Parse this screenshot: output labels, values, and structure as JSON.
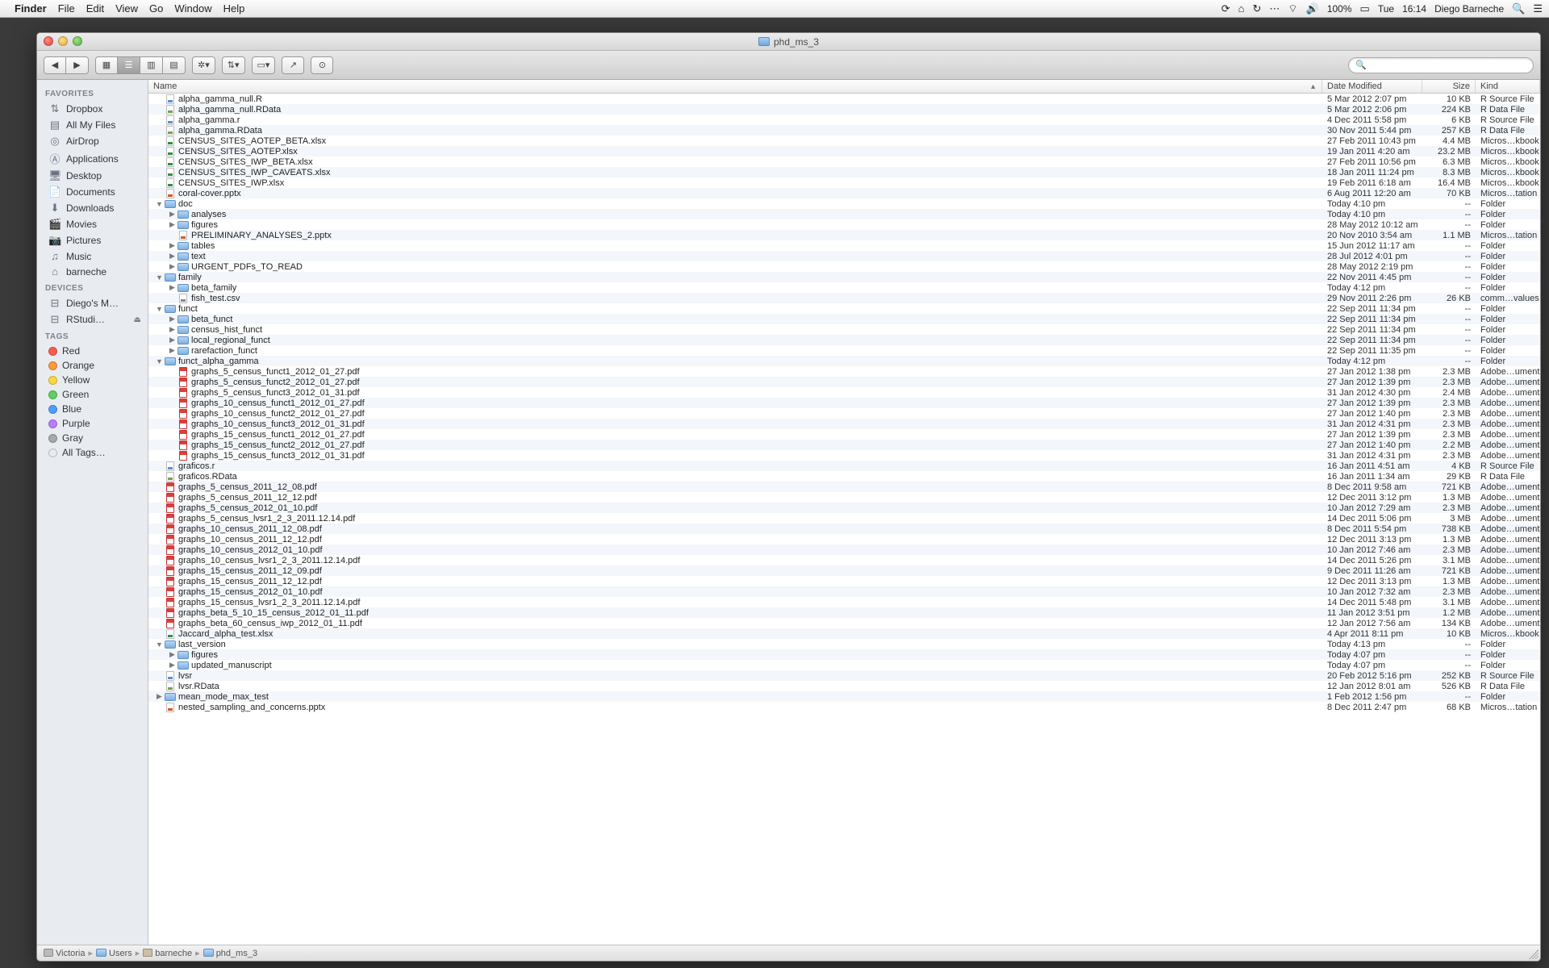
{
  "menubar": {
    "app": "Finder",
    "items": [
      "File",
      "Edit",
      "View",
      "Go",
      "Window",
      "Help"
    ],
    "battery": "100%",
    "day": "Tue",
    "time": "16:14",
    "user": "Diego Barneche"
  },
  "window": {
    "title": "phd_ms_3",
    "search_placeholder": ""
  },
  "sidebar": {
    "sections": [
      {
        "title": "FAVORITES",
        "items": [
          {
            "icon": "dropbox",
            "label": "Dropbox"
          },
          {
            "icon": "allfiles",
            "label": "All My Files"
          },
          {
            "icon": "airdrop",
            "label": "AirDrop"
          },
          {
            "icon": "apps",
            "label": "Applications"
          },
          {
            "icon": "desktop",
            "label": "Desktop"
          },
          {
            "icon": "docs",
            "label": "Documents"
          },
          {
            "icon": "downloads",
            "label": "Downloads"
          },
          {
            "icon": "movies",
            "label": "Movies"
          },
          {
            "icon": "pictures",
            "label": "Pictures"
          },
          {
            "icon": "music",
            "label": "Music"
          },
          {
            "icon": "home",
            "label": "barneche"
          }
        ]
      },
      {
        "title": "DEVICES",
        "items": [
          {
            "icon": "disk",
            "label": "Diego's M…"
          },
          {
            "icon": "disk",
            "label": "RStudi…",
            "eject": true
          }
        ]
      },
      {
        "title": "TAGS",
        "items": [
          {
            "tag": "#ff5b4f",
            "label": "Red"
          },
          {
            "tag": "#ff9a3c",
            "label": "Orange"
          },
          {
            "tag": "#ffd93c",
            "label": "Yellow"
          },
          {
            "tag": "#5fcf5f",
            "label": "Green"
          },
          {
            "tag": "#4f9eff",
            "label": "Blue"
          },
          {
            "tag": "#b97dff",
            "label": "Purple"
          },
          {
            "tag": "#a8a8a8",
            "label": "Gray"
          },
          {
            "tag": "transparent",
            "label": "All Tags…",
            "border": "#bbb"
          }
        ]
      }
    ]
  },
  "columns": {
    "name": "Name",
    "date": "Date Modified",
    "size": "Size",
    "kind": "Kind"
  },
  "pathbar": [
    "Victoria",
    "Users",
    "barneche",
    "phd_ms_3"
  ],
  "files": [
    {
      "d": 0,
      "t": null,
      "k": "r",
      "n": "alpha_gamma_null.R",
      "dm": "5 Mar 2012 2:07 pm",
      "sz": "10 KB",
      "kd": "R Source File"
    },
    {
      "d": 0,
      "t": null,
      "k": "rd",
      "n": "alpha_gamma_null.RData",
      "dm": "5 Mar 2012 2:06 pm",
      "sz": "224 KB",
      "kd": "R Data File"
    },
    {
      "d": 0,
      "t": null,
      "k": "r",
      "n": "alpha_gamma.r",
      "dm": "4 Dec 2011 5:58 pm",
      "sz": "6 KB",
      "kd": "R Source File"
    },
    {
      "d": 0,
      "t": null,
      "k": "rd",
      "n": "alpha_gamma.RData",
      "dm": "30 Nov 2011 5:44 pm",
      "sz": "257 KB",
      "kd": "R Data File"
    },
    {
      "d": 0,
      "t": null,
      "k": "xl",
      "n": "CENSUS_SITES_AOTEP_BETA.xlsx",
      "dm": "27 Feb 2011 10:43 pm",
      "sz": "4.4 MB",
      "kd": "Micros…kbook"
    },
    {
      "d": 0,
      "t": null,
      "k": "xl",
      "n": "CENSUS_SITES_AOTEP.xlsx",
      "dm": "19 Jan 2011 4:20 am",
      "sz": "23.2 MB",
      "kd": "Micros…kbook"
    },
    {
      "d": 0,
      "t": null,
      "k": "xl",
      "n": "CENSUS_SITES_IWP_BETA.xlsx",
      "dm": "27 Feb 2011 10:56 pm",
      "sz": "6.3 MB",
      "kd": "Micros…kbook"
    },
    {
      "d": 0,
      "t": null,
      "k": "xl",
      "n": "CENSUS_SITES_IWP_CAVEATS.xlsx",
      "dm": "18 Jan 2011 11:24 pm",
      "sz": "8.3 MB",
      "kd": "Micros…kbook"
    },
    {
      "d": 0,
      "t": null,
      "k": "xl",
      "n": "CENSUS_SITES_IWP.xlsx",
      "dm": "19 Feb 2011 6:18 am",
      "sz": "16.4 MB",
      "kd": "Micros…kbook"
    },
    {
      "d": 0,
      "t": null,
      "k": "pp",
      "n": "coral-cover.pptx",
      "dm": "6 Aug 2011 12:20 am",
      "sz": "70 KB",
      "kd": "Micros…tation"
    },
    {
      "d": 0,
      "t": "open",
      "k": "folder",
      "n": "doc",
      "dm": "Today 4:10 pm",
      "sz": "--",
      "kd": "Folder"
    },
    {
      "d": 1,
      "t": "closed",
      "k": "folder",
      "n": "analyses",
      "dm": "Today 4:10 pm",
      "sz": "--",
      "kd": "Folder"
    },
    {
      "d": 1,
      "t": "closed",
      "k": "folder",
      "n": "figures",
      "dm": "28 May 2012 10:12 am",
      "sz": "--",
      "kd": "Folder"
    },
    {
      "d": 1,
      "t": null,
      "k": "pp",
      "n": "PRELIMINARY_ANALYSES_2.pptx",
      "dm": "20 Nov 2010 3:54 am",
      "sz": "1.1 MB",
      "kd": "Micros…tation"
    },
    {
      "d": 1,
      "t": "closed",
      "k": "folder",
      "n": "tables",
      "dm": "15 Jun 2012 11:17 am",
      "sz": "--",
      "kd": "Folder"
    },
    {
      "d": 1,
      "t": "closed",
      "k": "folder",
      "n": "text",
      "dm": "28 Jul 2012 4:01 pm",
      "sz": "--",
      "kd": "Folder"
    },
    {
      "d": 1,
      "t": "closed",
      "k": "folder",
      "n": "URGENT_PDFs_TO_READ",
      "dm": "28 May 2012 2:19 pm",
      "sz": "--",
      "kd": "Folder"
    },
    {
      "d": 0,
      "t": "open",
      "k": "folder",
      "n": "family",
      "dm": "22 Nov 2011 4:45 pm",
      "sz": "--",
      "kd": "Folder"
    },
    {
      "d": 1,
      "t": "closed",
      "k": "folder",
      "n": "beta_family",
      "dm": "Today 4:12 pm",
      "sz": "--",
      "kd": "Folder"
    },
    {
      "d": 1,
      "t": null,
      "k": "csv",
      "n": "fish_test.csv",
      "dm": "29 Nov 2011 2:26 pm",
      "sz": "26 KB",
      "kd": "comm…values"
    },
    {
      "d": 0,
      "t": "open",
      "k": "folder",
      "n": "funct",
      "dm": "22 Sep 2011 11:34 pm",
      "sz": "--",
      "kd": "Folder"
    },
    {
      "d": 1,
      "t": "closed",
      "k": "folder",
      "n": "beta_funct",
      "dm": "22 Sep 2011 11:34 pm",
      "sz": "--",
      "kd": "Folder"
    },
    {
      "d": 1,
      "t": "closed",
      "k": "folder",
      "n": "census_hist_funct",
      "dm": "22 Sep 2011 11:34 pm",
      "sz": "--",
      "kd": "Folder"
    },
    {
      "d": 1,
      "t": "closed",
      "k": "folder",
      "n": "local_regional_funct",
      "dm": "22 Sep 2011 11:34 pm",
      "sz": "--",
      "kd": "Folder"
    },
    {
      "d": 1,
      "t": "closed",
      "k": "folder",
      "n": "rarefaction_funct",
      "dm": "22 Sep 2011 11:35 pm",
      "sz": "--",
      "kd": "Folder"
    },
    {
      "d": 0,
      "t": "open",
      "k": "folder",
      "n": "funct_alpha_gamma",
      "dm": "Today 4:12 pm",
      "sz": "--",
      "kd": "Folder"
    },
    {
      "d": 1,
      "t": null,
      "k": "pdf",
      "n": "graphs_5_census_funct1_2012_01_27.pdf",
      "dm": "27 Jan 2012 1:38 pm",
      "sz": "2.3 MB",
      "kd": "Adobe…ument"
    },
    {
      "d": 1,
      "t": null,
      "k": "pdf",
      "n": "graphs_5_census_funct2_2012_01_27.pdf",
      "dm": "27 Jan 2012 1:39 pm",
      "sz": "2.3 MB",
      "kd": "Adobe…ument"
    },
    {
      "d": 1,
      "t": null,
      "k": "pdf",
      "n": "graphs_5_census_funct3_2012_01_31.pdf",
      "dm": "31 Jan 2012 4:30 pm",
      "sz": "2.4 MB",
      "kd": "Adobe…ument"
    },
    {
      "d": 1,
      "t": null,
      "k": "pdf",
      "n": "graphs_10_census_funct1_2012_01_27.pdf",
      "dm": "27 Jan 2012 1:39 pm",
      "sz": "2.3 MB",
      "kd": "Adobe…ument"
    },
    {
      "d": 1,
      "t": null,
      "k": "pdf",
      "n": "graphs_10_census_funct2_2012_01_27.pdf",
      "dm": "27 Jan 2012 1:40 pm",
      "sz": "2.3 MB",
      "kd": "Adobe…ument"
    },
    {
      "d": 1,
      "t": null,
      "k": "pdf",
      "n": "graphs_10_census_funct3_2012_01_31.pdf",
      "dm": "31 Jan 2012 4:31 pm",
      "sz": "2.3 MB",
      "kd": "Adobe…ument"
    },
    {
      "d": 1,
      "t": null,
      "k": "pdf",
      "n": "graphs_15_census_funct1_2012_01_27.pdf",
      "dm": "27 Jan 2012 1:39 pm",
      "sz": "2.3 MB",
      "kd": "Adobe…ument"
    },
    {
      "d": 1,
      "t": null,
      "k": "pdf",
      "n": "graphs_15_census_funct2_2012_01_27.pdf",
      "dm": "27 Jan 2012 1:40 pm",
      "sz": "2.2 MB",
      "kd": "Adobe…ument"
    },
    {
      "d": 1,
      "t": null,
      "k": "pdf",
      "n": "graphs_15_census_funct3_2012_01_31.pdf",
      "dm": "31 Jan 2012 4:31 pm",
      "sz": "2.3 MB",
      "kd": "Adobe…ument"
    },
    {
      "d": 0,
      "t": null,
      "k": "r",
      "n": "graficos.r",
      "dm": "16 Jan 2011 4:51 am",
      "sz": "4 KB",
      "kd": "R Source File"
    },
    {
      "d": 0,
      "t": null,
      "k": "rd",
      "n": "graficos.RData",
      "dm": "16 Jan 2011 1:34 am",
      "sz": "29 KB",
      "kd": "R Data File"
    },
    {
      "d": 0,
      "t": null,
      "k": "pdf",
      "n": "graphs_5_census_2011_12_08.pdf",
      "dm": "8 Dec 2011 9:58 am",
      "sz": "721 KB",
      "kd": "Adobe…ument"
    },
    {
      "d": 0,
      "t": null,
      "k": "pdf",
      "n": "graphs_5_census_2011_12_12.pdf",
      "dm": "12 Dec 2011 3:12 pm",
      "sz": "1.3 MB",
      "kd": "Adobe…ument"
    },
    {
      "d": 0,
      "t": null,
      "k": "pdf",
      "n": "graphs_5_census_2012_01_10.pdf",
      "dm": "10 Jan 2012 7:29 am",
      "sz": "2.3 MB",
      "kd": "Adobe…ument"
    },
    {
      "d": 0,
      "t": null,
      "k": "pdf",
      "n": "graphs_5_census_lvsr1_2_3_2011.12.14.pdf",
      "dm": "14 Dec 2011 5:06 pm",
      "sz": "3 MB",
      "kd": "Adobe…ument"
    },
    {
      "d": 0,
      "t": null,
      "k": "pdf",
      "n": "graphs_10_census_2011_12_08.pdf",
      "dm": "8 Dec 2011 5:54 pm",
      "sz": "738 KB",
      "kd": "Adobe…ument"
    },
    {
      "d": 0,
      "t": null,
      "k": "pdf",
      "n": "graphs_10_census_2011_12_12.pdf",
      "dm": "12 Dec 2011 3:13 pm",
      "sz": "1.3 MB",
      "kd": "Adobe…ument"
    },
    {
      "d": 0,
      "t": null,
      "k": "pdf",
      "n": "graphs_10_census_2012_01_10.pdf",
      "dm": "10 Jan 2012 7:46 am",
      "sz": "2.3 MB",
      "kd": "Adobe…ument"
    },
    {
      "d": 0,
      "t": null,
      "k": "pdf",
      "n": "graphs_10_census_lvsr1_2_3_2011.12.14.pdf",
      "dm": "14 Dec 2011 5:26 pm",
      "sz": "3.1 MB",
      "kd": "Adobe…ument"
    },
    {
      "d": 0,
      "t": null,
      "k": "pdf",
      "n": "graphs_15_census_2011_12_09.pdf",
      "dm": "9 Dec 2011 11:26 am",
      "sz": "721 KB",
      "kd": "Adobe…ument"
    },
    {
      "d": 0,
      "t": null,
      "k": "pdf",
      "n": "graphs_15_census_2011_12_12.pdf",
      "dm": "12 Dec 2011 3:13 pm",
      "sz": "1.3 MB",
      "kd": "Adobe…ument"
    },
    {
      "d": 0,
      "t": null,
      "k": "pdf",
      "n": "graphs_15_census_2012_01_10.pdf",
      "dm": "10 Jan 2012 7:32 am",
      "sz": "2.3 MB",
      "kd": "Adobe…ument"
    },
    {
      "d": 0,
      "t": null,
      "k": "pdf",
      "n": "graphs_15_census_lvsr1_2_3_2011.12.14.pdf",
      "dm": "14 Dec 2011 5:48 pm",
      "sz": "3.1 MB",
      "kd": "Adobe…ument"
    },
    {
      "d": 0,
      "t": null,
      "k": "pdf",
      "n": "graphs_beta_5_10_15_census_2012_01_11.pdf",
      "dm": "11 Jan 2012 3:51 pm",
      "sz": "1.2 MB",
      "kd": "Adobe…ument"
    },
    {
      "d": 0,
      "t": null,
      "k": "pdf",
      "n": "graphs_beta_60_census_iwp_2012_01_11.pdf",
      "dm": "12 Jan 2012 7:56 am",
      "sz": "134 KB",
      "kd": "Adobe…ument"
    },
    {
      "d": 0,
      "t": null,
      "k": "xl",
      "n": "Jaccard_alpha_test.xlsx",
      "dm": "4 Apr 2011 8:11 pm",
      "sz": "10 KB",
      "kd": "Micros…kbook"
    },
    {
      "d": 0,
      "t": "open",
      "k": "folder",
      "n": "last_version",
      "dm": "Today 4:13 pm",
      "sz": "--",
      "kd": "Folder"
    },
    {
      "d": 1,
      "t": "closed",
      "k": "folder",
      "n": "figures",
      "dm": "Today 4:07 pm",
      "sz": "--",
      "kd": "Folder"
    },
    {
      "d": 1,
      "t": "closed",
      "k": "folder",
      "n": "updated_manuscript",
      "dm": "Today 4:07 pm",
      "sz": "--",
      "kd": "Folder"
    },
    {
      "d": 0,
      "t": null,
      "k": "r",
      "n": "lvsr",
      "dm": "20 Feb 2012 5:16 pm",
      "sz": "252 KB",
      "kd": "R Source File"
    },
    {
      "d": 0,
      "t": null,
      "k": "rd",
      "n": "lvsr.RData",
      "dm": "12 Jan 2012 8:01 am",
      "sz": "526 KB",
      "kd": "R Data File"
    },
    {
      "d": 0,
      "t": "closed",
      "k": "folder",
      "n": "mean_mode_max_test",
      "dm": "1 Feb 2012 1:56 pm",
      "sz": "--",
      "kd": "Folder"
    },
    {
      "d": 0,
      "t": null,
      "k": "pp",
      "n": "nested_sampling_and_concerns.pptx",
      "dm": "8 Dec 2011 2:47 pm",
      "sz": "68 KB",
      "kd": "Micros…tation"
    }
  ]
}
